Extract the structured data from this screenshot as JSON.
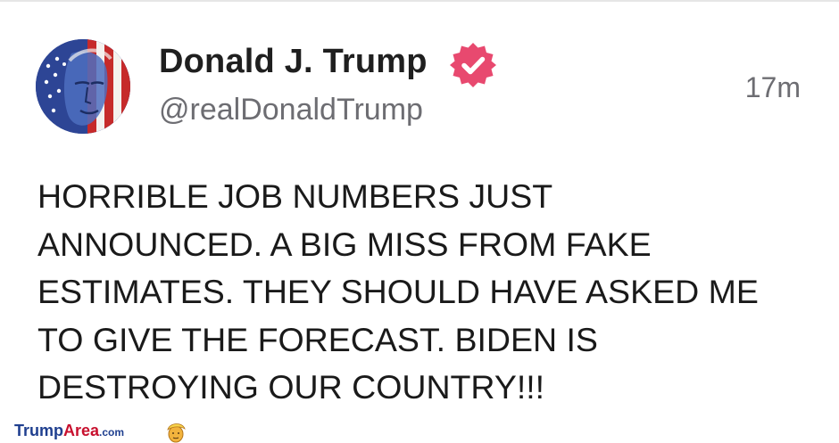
{
  "post": {
    "display_name": "Donald J. Trump",
    "handle": "@realDonaldTrump",
    "timestamp": "17m",
    "verified_icon": "verified-badge-icon",
    "verified_color": "#e8496f",
    "lines": [
      "HORRIBLE JOB NUMBERS JUST",
      "ANNOUNCED. A BIG MISS FROM FAKE",
      "ESTIMATES. THEY SHOULD HAVE ASKED ME",
      "TO GIVE THE FORECAST. BIDEN IS",
      "DESTROYING OUR COUNTRY!!!"
    ]
  },
  "watermark": {
    "part_trump": "Trump",
    "part_area": "Area",
    "part_com": ".com",
    "brand_blue": "#1f3f8f",
    "brand_red": "#c8102e"
  }
}
